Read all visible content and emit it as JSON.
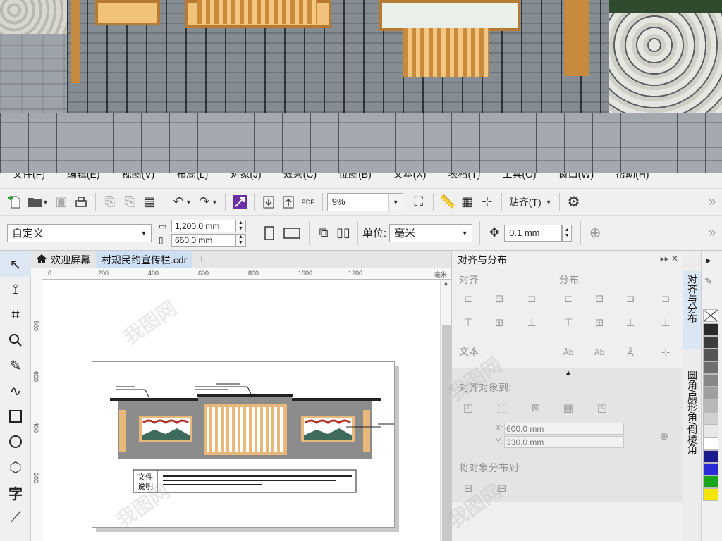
{
  "menu": [
    "文件(F)",
    "编辑(E)",
    "视图(V)",
    "布局(L)",
    "对象(J)",
    "效果(C)",
    "位图(B)",
    "文本(X)",
    "表格(T)",
    "工具(O)",
    "窗口(W)",
    "帮助(H)"
  ],
  "toolbar": {
    "zoom_value": "9%",
    "snap_label": "贴齐(T)",
    "pdf_label": "PDF"
  },
  "propertybar": {
    "page_preset": "自定义",
    "width": "1,200.0 mm",
    "height": "660.0 mm",
    "unit_label": "单位:",
    "unit_value": "毫米",
    "nudge": "0.1 mm"
  },
  "tabs": {
    "welcome": "欢迎屏幕",
    "document": "村规民约宣传栏.cdr",
    "add": "+"
  },
  "ruler": {
    "h_ticks": [
      "0",
      "200",
      "400",
      "600",
      "800",
      "1000",
      "1200"
    ],
    "h_unit": "毫米",
    "v_ticks": [
      "800",
      "600",
      "400",
      "200"
    ]
  },
  "drawing": {
    "caption_line1": "文件",
    "caption_line2": "说明"
  },
  "docker": {
    "title": "对齐与分布",
    "align_label": "对齐",
    "distribute_label": "分布",
    "text_label": "文本",
    "align_to_label": "对齐对象到:",
    "x_label": "X:",
    "x_value": "600.0 mm",
    "y_label": "Y:",
    "y_value": "330.0 mm",
    "distribute_to_label": "将对象分布到:"
  },
  "side_tabs": [
    "对齐与分布",
    "圆角/扇形角/倒棱角"
  ],
  "palette_colors": [
    "#2b2b2b",
    "#3d3d3d",
    "#555555",
    "#6e6e6e",
    "#878787",
    "#a0a0a0",
    "#b8b8b8",
    "#d0d0d0",
    "#e8e8e8",
    "#ffffff",
    "#1b1b8f",
    "#2a2ad8",
    "#1aa61a",
    "#f3e600"
  ],
  "watermark": "我图网"
}
